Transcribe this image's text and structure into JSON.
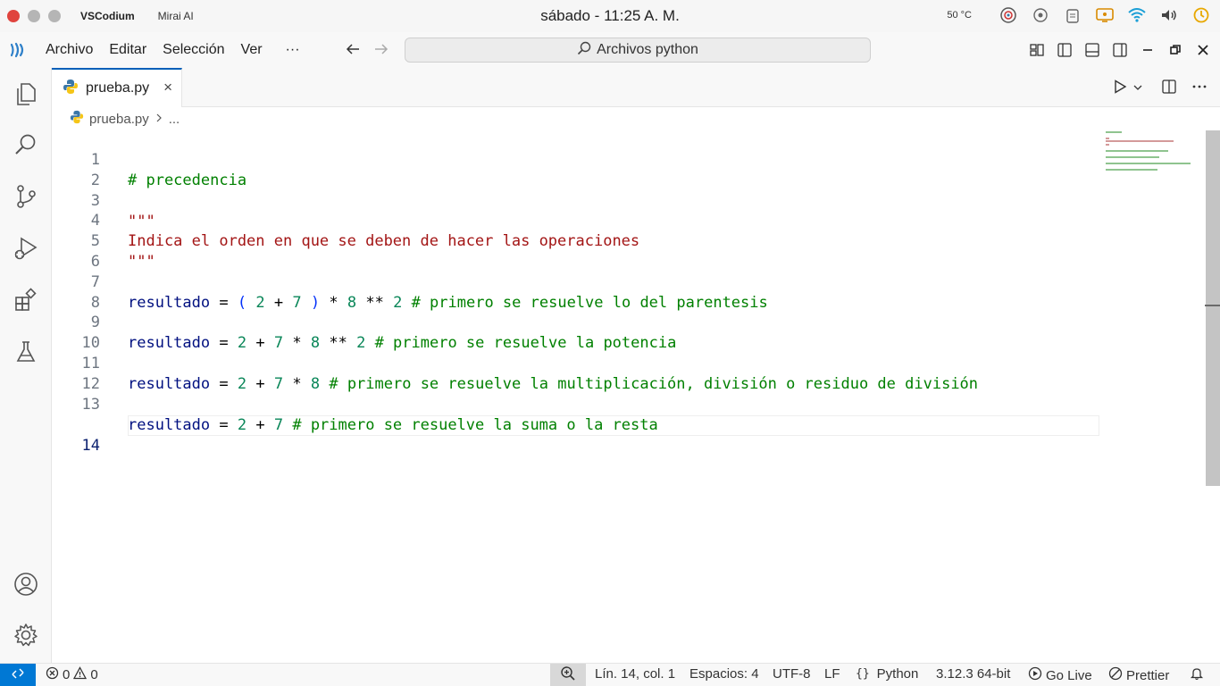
{
  "os": {
    "app_name": "VSCodium",
    "window_name": "Mirai AI",
    "clock": "sábado - 11:25 A. M.",
    "temperature": "50 °C"
  },
  "menu": {
    "items": [
      "Archivo",
      "Editar",
      "Selección",
      "Ver"
    ],
    "more": "···",
    "search_label": "Archivos python"
  },
  "tab": {
    "filename": "prueba.py",
    "close": "×"
  },
  "breadcrumb": {
    "file": "prueba.py",
    "rest": "..."
  },
  "editor": {
    "lines": [
      {
        "num": "1"
      },
      {
        "num": "2"
      },
      {
        "num": "3"
      },
      {
        "num": "4"
      },
      {
        "num": "5"
      },
      {
        "num": "6"
      },
      {
        "num": "7"
      },
      {
        "num": "8"
      },
      {
        "num": "9"
      },
      {
        "num": "10"
      },
      {
        "num": "11"
      },
      {
        "num": "12"
      },
      {
        "num": "13"
      },
      {
        "num": "14"
      }
    ],
    "code": {
      "l1_comment": "# precedencia",
      "l3_str": "\"\"\"",
      "l4_str": "Indica el orden en que se deben de hacer las operaciones",
      "l5_str": "\"\"\"",
      "var": "resultado",
      "l7_comment": "# primero se resuelve lo del parentesis",
      "l9_comment": "# primero se resuelve la potencia",
      "l11_comment": "# primero se resuelve la multiplicación, división o residuo de división",
      "l13_comment": "# primero se resuelve la suma o la resta"
    },
    "active_line": 14
  },
  "status": {
    "errors": "0",
    "warnings": "0",
    "position": "Lín. 14, col. 1",
    "spaces": "Espacios: 4",
    "encoding": "UTF-8",
    "eol": "LF",
    "language": "Python",
    "interpreter": "3.12.3 64-bit",
    "go_live": "Go Live",
    "prettier": "Prettier"
  },
  "colors": {
    "accent": "#005fb8",
    "remote": "#0078d4",
    "comment": "#008000",
    "string": "#a31515",
    "variable": "#001080",
    "number": "#098658"
  },
  "icons": {
    "activity": [
      "explorer-icon",
      "search-icon",
      "source-control-icon",
      "run-debug-icon",
      "extensions-icon",
      "testing-icon",
      "account-icon",
      "settings-gear-icon"
    ]
  }
}
